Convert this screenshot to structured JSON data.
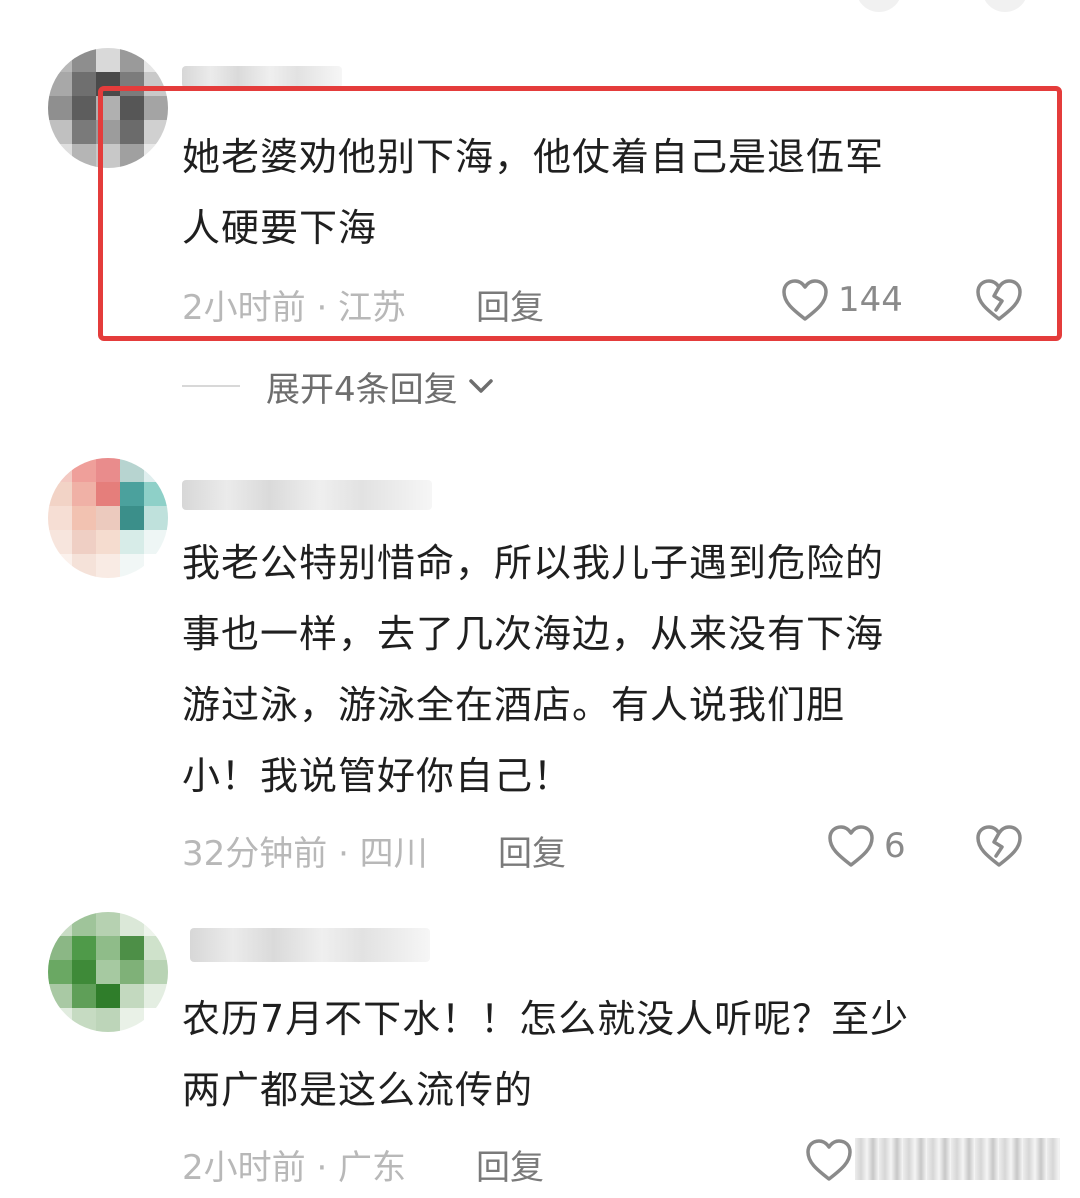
{
  "comments": [
    {
      "text_lines": [
        "她老婆劝他别下海，他仗着自己是退伍军",
        "人硬要下海"
      ],
      "meta": "2小时前 · 江苏",
      "reply_label": "回复",
      "likes": "144",
      "expand_label": "展开4条回复"
    },
    {
      "text_lines": [
        "我老公特别惜命，所以我儿子遇到危险的",
        "事也一样，去了几次海边，从来没有下海",
        "游过泳，游泳全在酒店。有人说我们胆",
        "小！我说管好你自己！"
      ],
      "meta": "32分钟前 · 四川",
      "reply_label": "回复",
      "likes": "6"
    },
    {
      "text_lines": [
        "农历7月不下水！！怎么就没人听呢？至少",
        "两广都是这么流传的"
      ],
      "meta": "2小时前 · 广东",
      "reply_label": "回复",
      "likes": ""
    }
  ],
  "colors": {
    "highlight_border": "#e43c3b",
    "text": "#1f1f1f",
    "meta": "#b8b8b8",
    "icon": "#8a8a8a"
  },
  "icons": {
    "like": "heart-icon",
    "dislike": "broken-heart-icon",
    "expand": "chevron-down-icon"
  }
}
